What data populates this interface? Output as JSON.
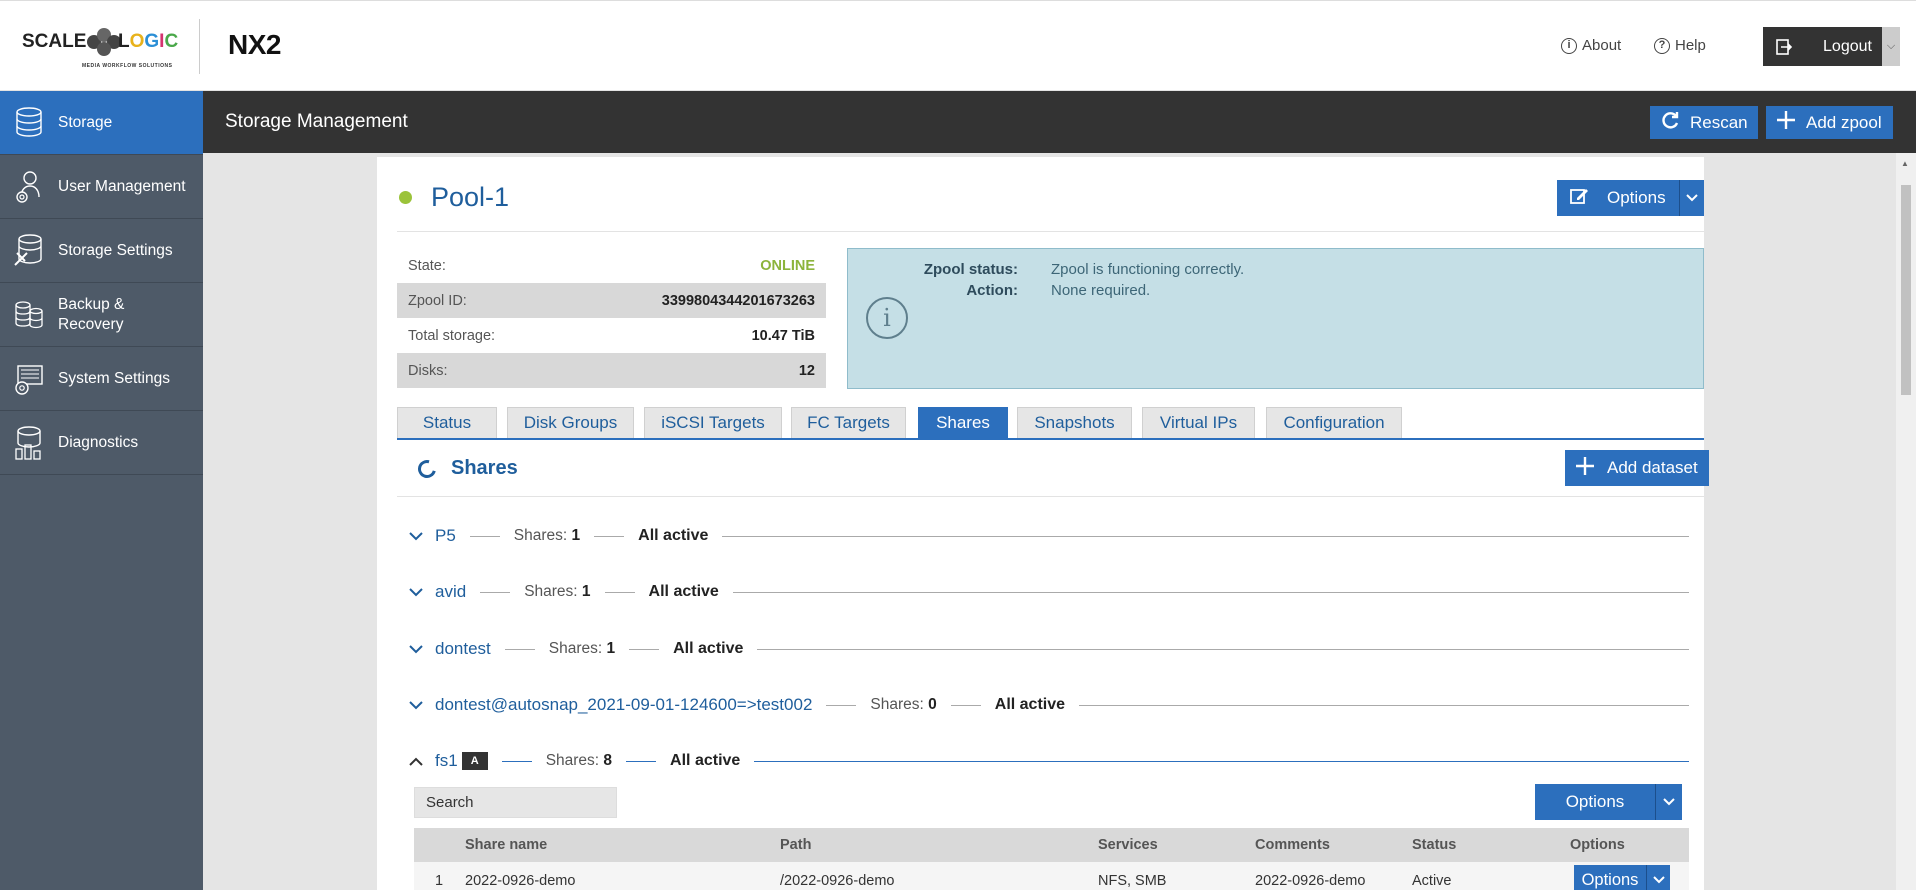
{
  "header": {
    "logo_text_left": "SCALE",
    "logo_text_right": "LOGIC",
    "logo_tagline": "MEDIA WORKFLOW SOLUTIONS",
    "product": "NX2",
    "about": "About",
    "help": "Help",
    "logout": "Logout"
  },
  "sidebar": {
    "items": [
      {
        "label": "Storage",
        "icon": "storage-icon",
        "active": true
      },
      {
        "label": "User Management",
        "icon": "user-management-icon"
      },
      {
        "label": "Storage Settings",
        "icon": "storage-settings-icon"
      },
      {
        "label": "Backup & Recovery",
        "icon": "backup-recovery-icon"
      },
      {
        "label": "System Settings",
        "icon": "system-settings-icon"
      },
      {
        "label": "Diagnostics",
        "icon": "diagnostics-icon"
      }
    ]
  },
  "titlebar": {
    "title": "Storage Management",
    "rescan": "Rescan",
    "add_zpool": "Add zpool"
  },
  "pool": {
    "name": "Pool-1",
    "options": "Options",
    "info": [
      {
        "key": "State:",
        "value": "ONLINE"
      },
      {
        "key": "Zpool ID:",
        "value": "3399804344201673263"
      },
      {
        "key": "Total storage:",
        "value": "10.47 TiB"
      },
      {
        "key": "Disks:",
        "value": "12"
      }
    ],
    "status_label": "Zpool status:",
    "status_value": "Zpool is functioning correctly.",
    "action_label": "Action:",
    "action_value": "None required."
  },
  "tabs": [
    "Status",
    "Disk Groups",
    "iSCSI Targets",
    "FC Targets",
    "Shares",
    "Snapshots",
    "Virtual IPs",
    "Configuration"
  ],
  "active_tab": "Shares",
  "shares": {
    "heading": "Shares",
    "add_dataset": "Add dataset",
    "shares_label": "Shares:",
    "datasets": [
      {
        "name": "P5",
        "count": "1",
        "status": "All active",
        "expanded": false
      },
      {
        "name": "avid",
        "count": "1",
        "status": "All active",
        "expanded": false
      },
      {
        "name": "dontest",
        "count": "1",
        "status": "All active",
        "expanded": false
      },
      {
        "name": "dontest@autosnap_2021-09-01-124600=>test002",
        "count": "0",
        "status": "All active",
        "expanded": false
      },
      {
        "name": "fs1",
        "badge": "A",
        "count": "8",
        "status": "All active",
        "expanded": true
      }
    ],
    "search_placeholder": "Search",
    "table_options": "Options",
    "columns": [
      "Share name",
      "Path",
      "Services",
      "Comments",
      "Status",
      "Options"
    ],
    "rows": [
      {
        "num": "1",
        "name": "2022-0926-demo",
        "path": "/2022-0926-demo",
        "services": "NFS, SMB",
        "comments": "2022-0926-demo",
        "status": "Active",
        "options": "Options"
      }
    ]
  },
  "colors": {
    "accent": "#2c6fbd",
    "sidebar": "#4e5a68",
    "titlebar": "#333333",
    "online": "#8cb43b",
    "info_box": "#c5dfe6"
  }
}
